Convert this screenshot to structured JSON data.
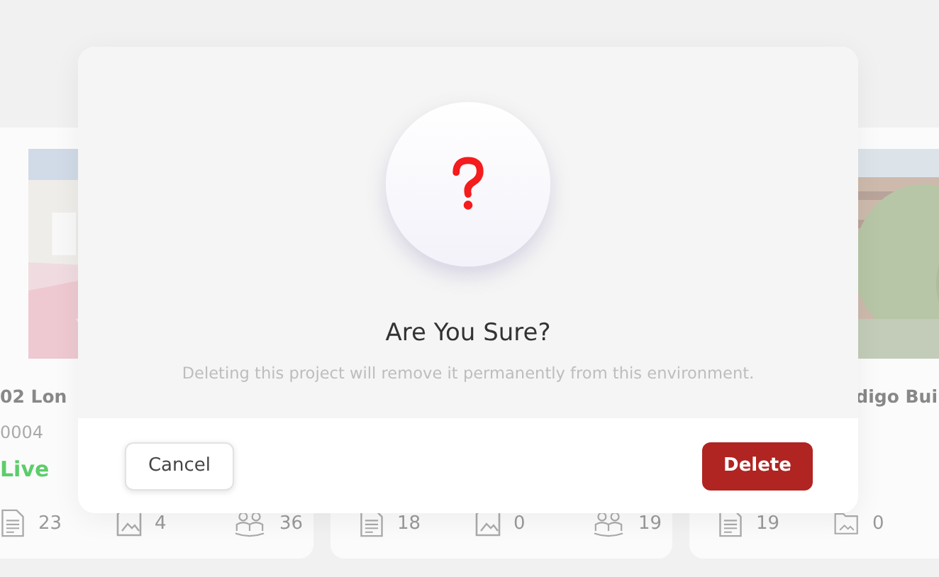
{
  "cards": [
    {
      "title": "02 Lon",
      "code": "0004",
      "status": {
        "label": "Live",
        "color": "#5ccd6a"
      },
      "stats": [
        {
          "kind": "documents",
          "value": "23"
        },
        {
          "kind": "gallery",
          "value": "4"
        },
        {
          "kind": "team",
          "value": "36"
        }
      ]
    },
    {
      "stats": [
        {
          "kind": "documents",
          "value": "18"
        },
        {
          "kind": "gallery",
          "value": "0"
        },
        {
          "kind": "team",
          "value": "19"
        }
      ]
    },
    {
      "title": "digo Bui",
      "stats": [
        {
          "kind": "documents",
          "value": "19"
        },
        {
          "kind": "folder",
          "value": "0"
        }
      ]
    }
  ],
  "dialog": {
    "title": "Are You Sure?",
    "message": "Deleting this project will remove it permanently from this environment.",
    "buttons": [
      {
        "kind": "secondary",
        "label": "Cancel"
      },
      {
        "kind": "danger",
        "label": "Delete"
      }
    ]
  }
}
